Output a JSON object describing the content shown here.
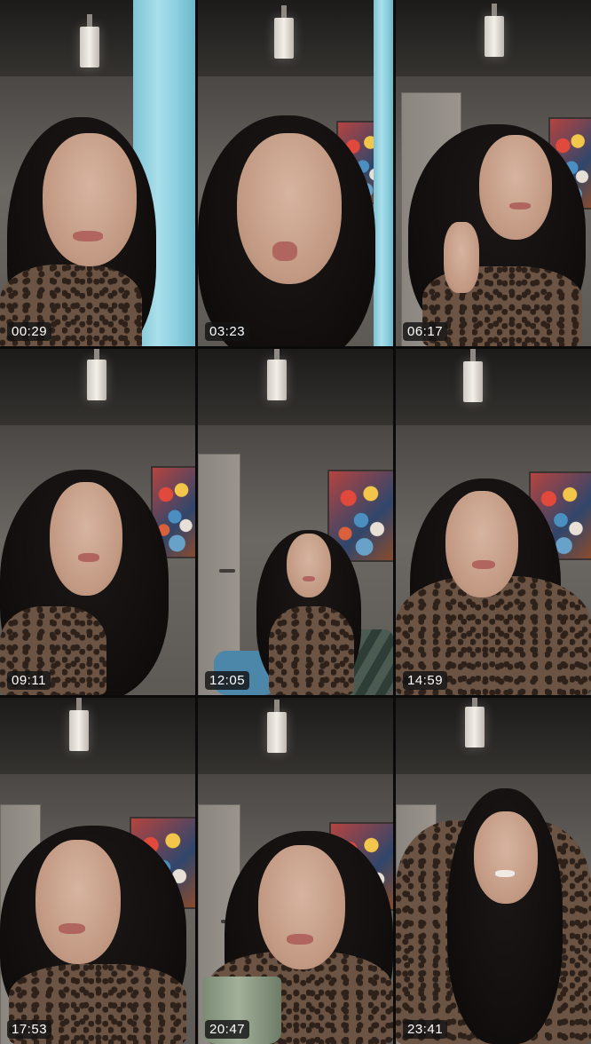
{
  "grid": {
    "columns": 3,
    "rows": 3,
    "thumbnails": [
      {
        "timestamp": "00:29",
        "scene": "curtain"
      },
      {
        "timestamp": "03:23",
        "scene": "curtain-closeup"
      },
      {
        "timestamp": "06:17",
        "scene": "hair-touch"
      },
      {
        "timestamp": "09:11",
        "scene": "lean-left"
      },
      {
        "timestamp": "12:05",
        "scene": "sofa-wide"
      },
      {
        "timestamp": "14:59",
        "scene": "sofa-medium"
      },
      {
        "timestamp": "17:53",
        "scene": "talking"
      },
      {
        "timestamp": "20:47",
        "scene": "mug"
      },
      {
        "timestamp": "23:41",
        "scene": "hands-on-head"
      }
    ]
  },
  "colors": {
    "background": "#000000",
    "timestamp_bg": "#141414",
    "timestamp_text": "#ffffff",
    "curtain": "#8ccfdf"
  }
}
